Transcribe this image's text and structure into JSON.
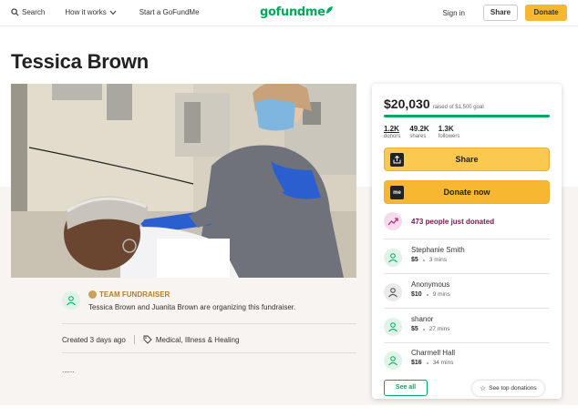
{
  "header": {
    "search_label": "Search",
    "how_label": "How it works",
    "start_label": "Start a GoFundMe",
    "logo_text": "gofundme",
    "signin_label": "Sign in",
    "share_label": "Share",
    "donate_label": "Donate"
  },
  "page": {
    "title": "Tessica Brown"
  },
  "organizer": {
    "team_label": "TEAM FUNDRAISER",
    "text": "Tessica Brown and Juanita Brown are organizing this fundraiser.",
    "created": "Created 3 days ago",
    "category": "Medical, Illness & Healing",
    "description": "......"
  },
  "campaign": {
    "raised": "$20,030",
    "goal_text": "raised of $1,500 goal",
    "progress_fraction": 1.0,
    "stats": [
      {
        "value": "1.2K",
        "label": "donors"
      },
      {
        "value": "49.2K",
        "label": "shares"
      },
      {
        "value": "1.3K",
        "label": "followers"
      }
    ],
    "share_button": "Share",
    "donate_button": "Donate now",
    "just_donated": "473 people just donated",
    "donations": [
      {
        "name": "Stephanie Smith",
        "amount": "$5",
        "time": "3 mins",
        "anonymous": false
      },
      {
        "name": "Anonymous",
        "amount": "$10",
        "time": "9 mins",
        "anonymous": true
      },
      {
        "name": "shanor",
        "amount": "$5",
        "time": "27 mins",
        "anonymous": false
      },
      {
        "name": "Charmell Hall",
        "amount": "$16",
        "time": "34 mins",
        "anonymous": false
      }
    ],
    "see_all": "See all",
    "see_top": "See top donations"
  },
  "colors": {
    "brand_green": "#02a95c",
    "donate_yellow": "#f7b731",
    "team_gold": "#b07f28",
    "just_donated": "#6b1a52"
  },
  "icons": [
    "search-icon",
    "chevron-down-icon",
    "leaf-logo-icon",
    "user-icon",
    "tag-icon",
    "share-icon",
    "gofundme-icon",
    "trend-icon",
    "star-icon"
  ]
}
